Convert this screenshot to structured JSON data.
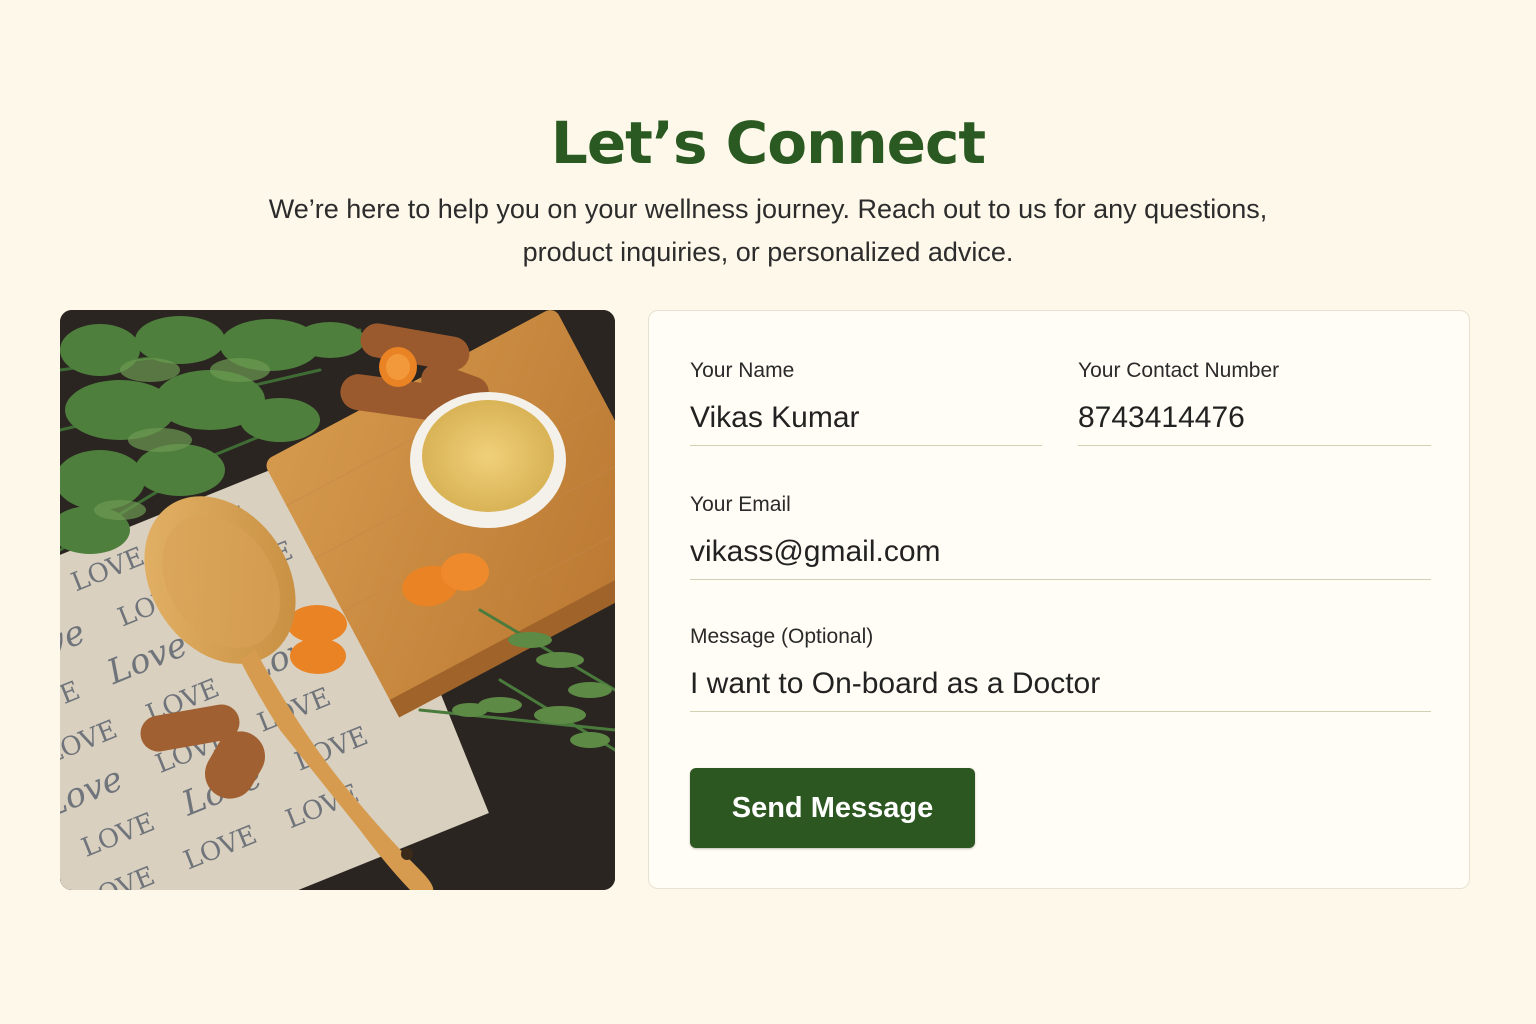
{
  "header": {
    "title": "Let’s Connect",
    "subtitle": "We’re here to help you on your wellness journey. Reach out to us for any questions, product inquiries, or personalized advice."
  },
  "form": {
    "name": {
      "label": "Your Name",
      "value": "Vikas Kumar"
    },
    "phone": {
      "label": "Your Contact Number",
      "value": "8743414476"
    },
    "email": {
      "label": "Your Email",
      "value": "vikass@gmail.com"
    },
    "message": {
      "label": "Message (Optional)",
      "value": "I want to On-board as a Doctor"
    },
    "submit_label": "Send Message"
  },
  "image": {
    "paper_text": "LOVE"
  },
  "colors": {
    "accent": "#2c5721",
    "title": "#2a5a22",
    "background": "#fdf8ea"
  }
}
